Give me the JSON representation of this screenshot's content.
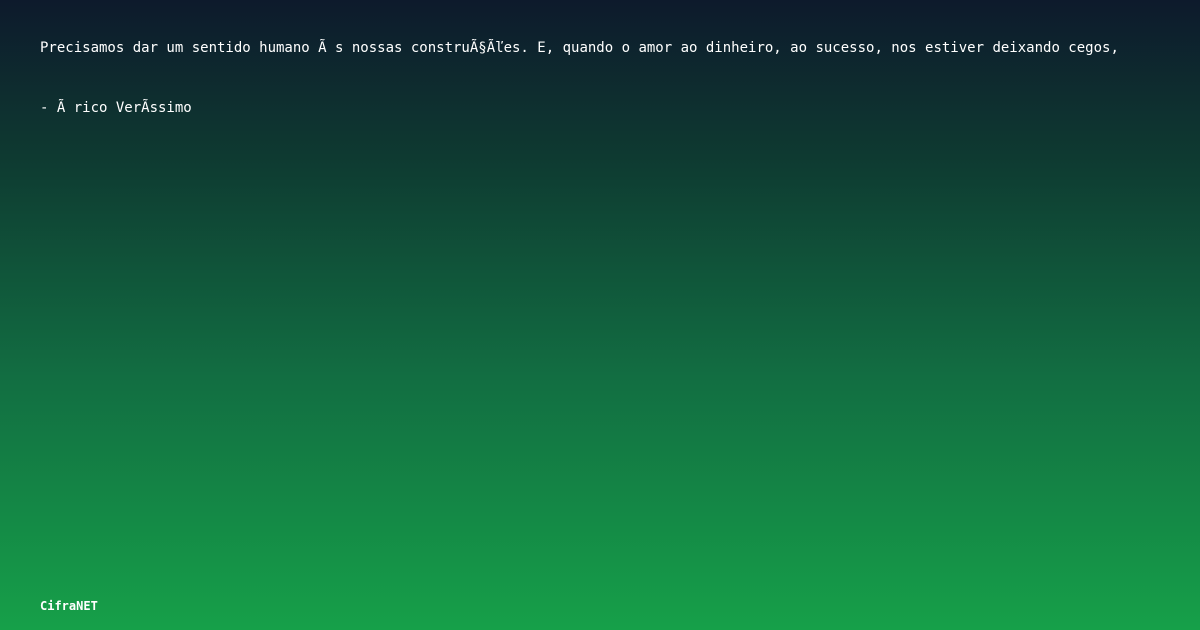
{
  "quote": {
    "text": "Precisamos dar um sentido humano Ã s nossas construÃ§Ãľes. E, quando o amor ao dinheiro, ao sucesso, nos estiver deixando cegos,",
    "author": "- Ã rico VerÃ­ssimo"
  },
  "brand": {
    "name": "CifraNET"
  },
  "colors": {
    "background_top": "#0d1a2c",
    "background_bottom": "#16a049",
    "text": "#ffffff"
  }
}
